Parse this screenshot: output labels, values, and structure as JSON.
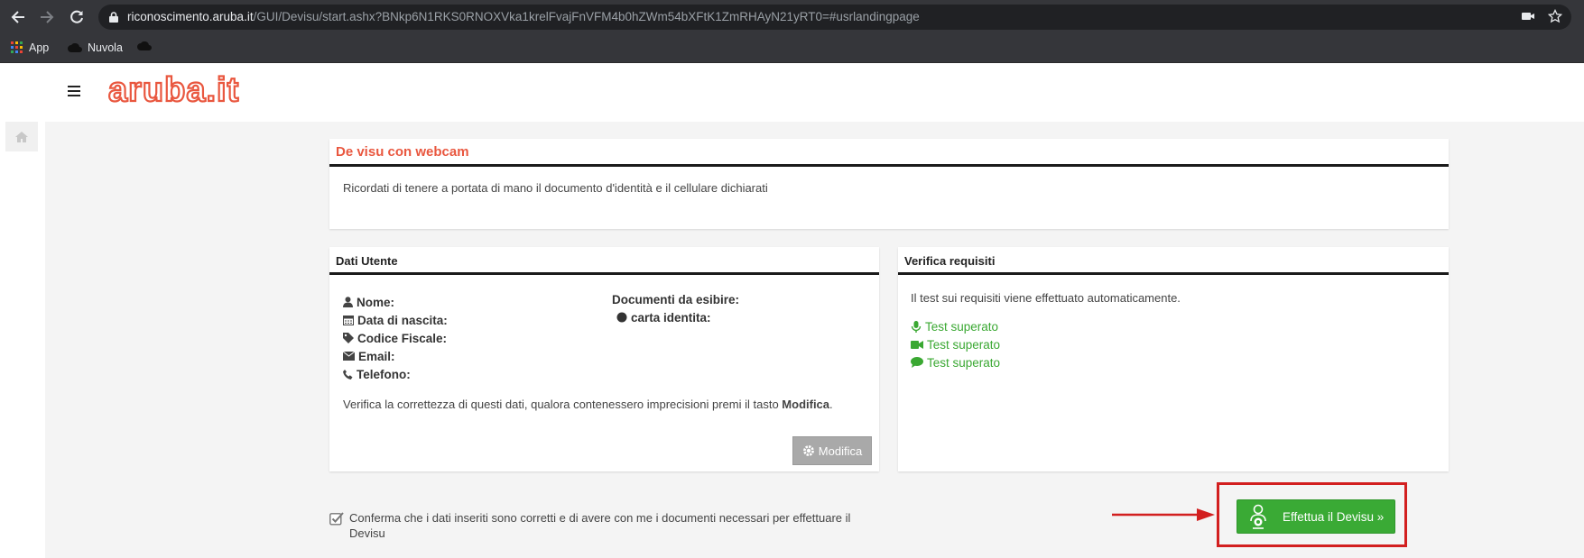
{
  "browser": {
    "url_host": "riconoscimento.aruba.it",
    "url_rest": "/GUI/Devisu/start.ashx?BNkp6N1RKS0RNOXVka1krelFvajFnVFM4b0hZWm54bXFtK1ZmRHAyN21yRT0=#usrlandingpage",
    "bookmarks": [
      "App",
      "Nuvola"
    ]
  },
  "site": {
    "logo_text": "aruba.it",
    "brand_color": "#e9573f"
  },
  "intro_panel": {
    "title": "De visu con webcam",
    "text": "Ricordati di tenere a portata di mano il documento d'identità e il cellulare dichiarati"
  },
  "user_panel": {
    "title": "Dati Utente",
    "fields": [
      "Nome:",
      "Data di nascita:",
      "Codice Fiscale:",
      "Email:",
      "Telefono:"
    ],
    "documents_label": "Documenti da esibire:",
    "document_item": "carta identita:",
    "note_prefix": "Verifica la correttezza di questi dati, qualora contenessero imprecisioni premi il tasto ",
    "note_bold": "Modifica",
    "note_suffix": ".",
    "edit_button": "Modifica"
  },
  "requirements_panel": {
    "title": "Verifica requisiti",
    "text": "Il test sui requisiti viene effettuato automaticamente.",
    "tests": [
      "Test superato",
      "Test superato",
      "Test superato"
    ],
    "success_color": "#3aa832"
  },
  "confirm": {
    "line1": "Conferma che i dati inseriti sono corretti e di avere con me i documenti necessari per effettuare il",
    "line2": "Devisu",
    "checked": true
  },
  "cta": {
    "label": "Effettua il Devisu »",
    "highlight_color": "#d21f1f"
  }
}
